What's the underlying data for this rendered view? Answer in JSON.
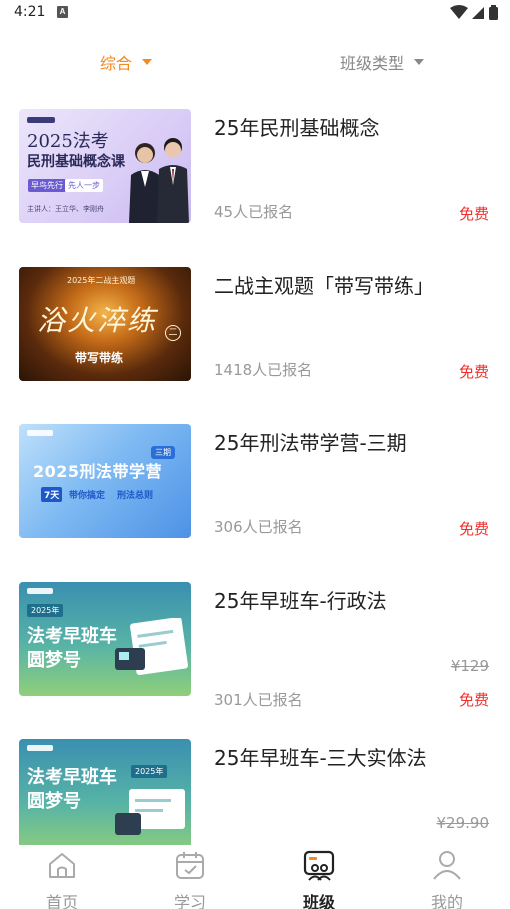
{
  "status_bar": {
    "time": "4:21",
    "notification_icon": "A"
  },
  "filters": {
    "comprehensive": "综合",
    "class_type": "班级类型"
  },
  "courses": [
    {
      "title": "25年民刑基础概念",
      "enrolled": "45人已报名",
      "price": "免费",
      "thumb": {
        "headline": "2025法考",
        "subheadline": "民刑基础概念课",
        "tag1": "早鸟先行",
        "tag2": "先人一步",
        "lecturers": "主讲人：王立华、李刚舟"
      }
    },
    {
      "title": "二战主观题「带写带练」",
      "enrolled": "1418人已报名",
      "price": "免费",
      "thumb": {
        "top": "2025年二战主观题",
        "headline": "浴火淬练",
        "badge": "二",
        "caption": "带写带练"
      }
    },
    {
      "title": "25年刑法带学营-三期",
      "enrolled": "306人已报名",
      "price": "免费",
      "thumb": {
        "period": "三期",
        "headline": "2025刑法带学营",
        "days": "7天",
        "caption1": "带你搞定",
        "caption2": "刑法总则"
      }
    },
    {
      "title": "25年早班车-行政法",
      "original_price": "¥129",
      "enrolled": "301人已报名",
      "price": "免费",
      "thumb": {
        "year": "2025年",
        "line1": "法考早班车",
        "line2": "圆梦号"
      }
    },
    {
      "title": "25年早班车-三大实体法",
      "original_price": "¥29.90",
      "thumb": {
        "year": "2025年",
        "line1": "法考早班车",
        "line2": "圆梦号"
      }
    }
  ],
  "bottom_nav": [
    {
      "label": "首页",
      "icon": "home-icon",
      "active": false
    },
    {
      "label": "学习",
      "icon": "calendar-icon",
      "active": false
    },
    {
      "label": "班级",
      "icon": "class-icon",
      "active": true
    },
    {
      "label": "我的",
      "icon": "profile-icon",
      "active": false
    }
  ],
  "colors": {
    "accent": "#f08a24",
    "price_free": "#f0302c",
    "muted": "#999999"
  }
}
